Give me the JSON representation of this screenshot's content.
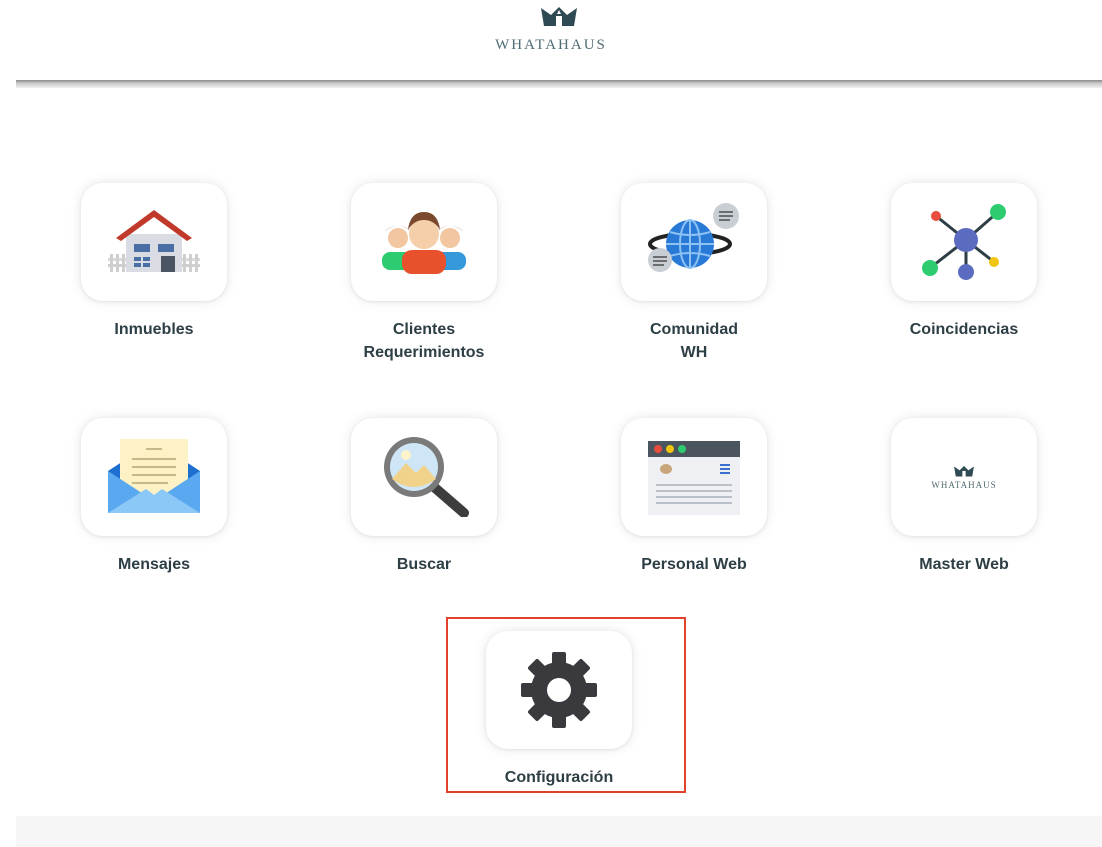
{
  "brand": {
    "name": "WHATAHAUS",
    "crown_color": "#2f4a52"
  },
  "menu": {
    "items": [
      {
        "key": "inmuebles",
        "label": "Inmuebles",
        "icon": "house-icon"
      },
      {
        "key": "clientes",
        "label": "Clientes\nRequerimientos",
        "icon": "people-group-icon"
      },
      {
        "key": "comunidad",
        "label": "Comunidad\nWH",
        "icon": "globe-chat-icon"
      },
      {
        "key": "coincidencias",
        "label": "Coincidencias",
        "icon": "network-nodes-icon"
      },
      {
        "key": "mensajes",
        "label": "Mensajes",
        "icon": "envelope-letter-icon"
      },
      {
        "key": "buscar",
        "label": "Buscar",
        "icon": "magnifier-icon"
      },
      {
        "key": "personal_web",
        "label": "Personal Web",
        "icon": "browser-window-icon"
      },
      {
        "key": "master_web",
        "label": "Master Web",
        "icon": "whatahaus-logo-icon",
        "logo_text": "WHATAHAUS"
      },
      {
        "key": "configuracion",
        "label": "Configuración",
        "icon": "gear-icon",
        "highlighted": true
      }
    ]
  },
  "colors": {
    "label_text": "#2d3e45",
    "highlight_border": "#e0432b"
  }
}
